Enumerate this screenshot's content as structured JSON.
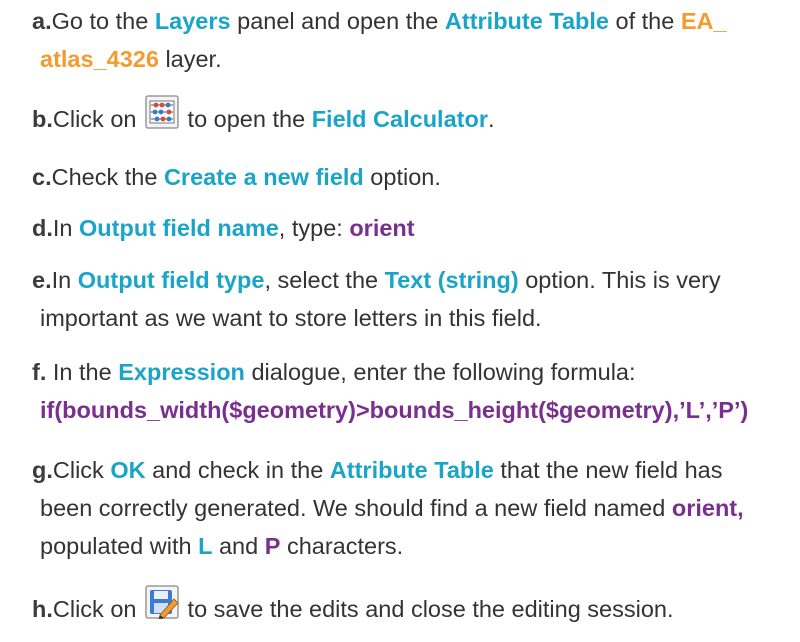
{
  "steps": [
    {
      "letter": "a.",
      "p1": "Go to the ",
      "layers": "Layers",
      "p2": " panel and open the ",
      "attr": "Attribute Table",
      "p3": " of the ",
      "layer1": "EA_",
      "layer2": "atlas_4326",
      "p4": " layer."
    },
    {
      "letter": "b.",
      "p1": "Click on ",
      "icon": "field-calculator-icon",
      "p2": " to open the ",
      "fc": "Field Calculator",
      "p3": "."
    },
    {
      "letter": "c.",
      "p1": "Check the ",
      "opt": "Create a new field",
      "p2": " option."
    },
    {
      "letter": "d.",
      "p1": "In ",
      "ofn": "Output field name",
      "p2": ", type: ",
      "val": "orient"
    },
    {
      "letter": "e.",
      "p1": "In ",
      "oft": "Output field type",
      "p2": ", select the ",
      "ts": "Text (string)",
      "p3": " option. This is very",
      "line2": "important as we want to store letters in this field."
    },
    {
      "letter": "f.",
      "p1": " In the ",
      "expr": "Expression",
      "p2": " dialogue, enter the following formula:",
      "formula": "if(bounds_width($geometry)>bounds_height($geometry),’L’,’P’)"
    },
    {
      "letter": "g.",
      "p1": "Click ",
      "ok": "OK",
      "p2": " and check in the ",
      "attr": "Attribute Table",
      "p3": " that the new field has",
      "line2a": "been correctly generated. We should find a new field named ",
      "orient": "orient,",
      "line3a": "populated with ",
      "L": "L",
      "and": " and ",
      "P": "P",
      "line3b": " characters."
    },
    {
      "letter": "h.",
      "p1": "Click on ",
      "icon": "save-edits-icon",
      "p2": " to save the edits and close the editing session."
    }
  ],
  "colors": {
    "keyword": "#1aa5c8",
    "layer": "#f39b2f",
    "value": "#7a2f8e",
    "text": "#333333"
  }
}
